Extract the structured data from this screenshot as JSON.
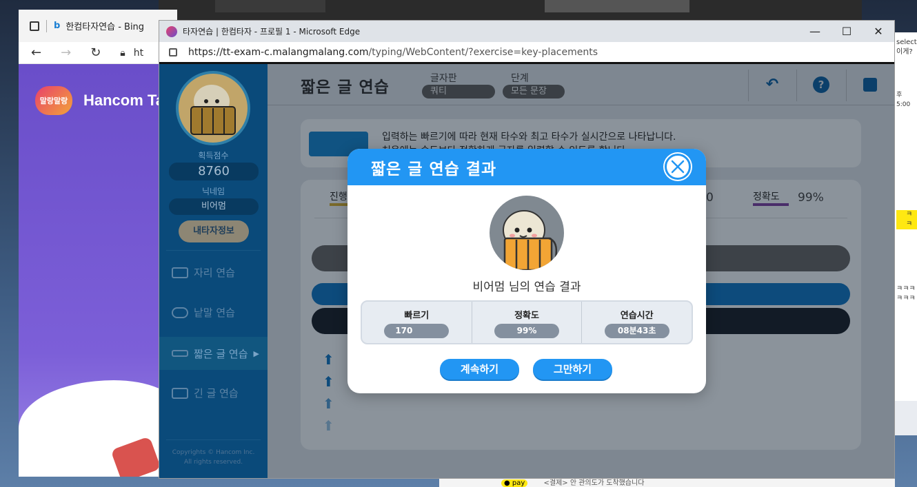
{
  "background_window": {
    "tab_title": "한컴타자연습 - Bing",
    "brand": "Hancom Ta",
    "brand_badge": "말랑말랑",
    "address_fragment": "ht"
  },
  "main_window": {
    "tab_title": "타자연습 | 한컴타자 - 프로필 1 - Microsoft Edge",
    "url_host": "https://tt-exam-c.malangmalang.com",
    "url_path": "/typing/WebContent/?exercise=key-placements",
    "controls": {
      "minimize": "—",
      "maximize": "☐",
      "close": "✕"
    }
  },
  "sidebar": {
    "score_label": "획득점수",
    "score_value": "8760",
    "nickname_label": "닉네임",
    "nickname_value": "비어멈",
    "my_info_button": "내타자정보",
    "menu": [
      {
        "label": "자리 연습",
        "icon": "keyboard-icon"
      },
      {
        "label": "낱말 연습",
        "icon": "chat-bubble-icon"
      },
      {
        "label": "짧은 글 연습",
        "icon": "short-text-icon",
        "active": true
      },
      {
        "label": "긴 글 연습",
        "icon": "long-text-icon"
      }
    ],
    "copyright_line1": "Copyrights © Hancom Inc.",
    "copyright_line2": "All rights reserved."
  },
  "header": {
    "title": "짧은 글 연습",
    "keyboard_label": "글자판",
    "keyboard_value": "쿼티",
    "level_label": "단계",
    "level_value": "모든 문장"
  },
  "info": {
    "line1": "입력하는 빠르기에 따라 현재 타수와 최고 타수가 실시간으로 나타납니다.",
    "line2": "처음에는 속도보다 정확하게 글자를 입력할 수 있도록 합니다."
  },
  "panel": {
    "progress_label": "진행",
    "accuracy_label": "정확도",
    "accuracy_value": "99%",
    "partial_value": "0"
  },
  "modal": {
    "title": "짧은 글 연습 결과",
    "result_name": "비어멈 님의 연습 결과",
    "stats": [
      {
        "label": "빠르기",
        "value": "170"
      },
      {
        "label": "정확도",
        "value": "99%"
      },
      {
        "label": "연습시간",
        "value": "08분43초"
      }
    ],
    "continue_button": "계속하기",
    "stop_button": "그만하기"
  },
  "right_partial": {
    "line1": "select",
    "line2": "이게?",
    "time": "후 5:00",
    "chat1": "ㅋㅋ",
    "chat2": "ㅋㅋㅋ",
    "chat3": "ㅋㅋㅋ"
  },
  "bottom_chat": {
    "badge": "● pay",
    "text": "<결제> 안 관의도가 도착했습니다"
  },
  "colors": {
    "modal_accent": "#2296f3",
    "sidebar_bg": "#0a4a7a",
    "stat_pill": "#84909f"
  }
}
